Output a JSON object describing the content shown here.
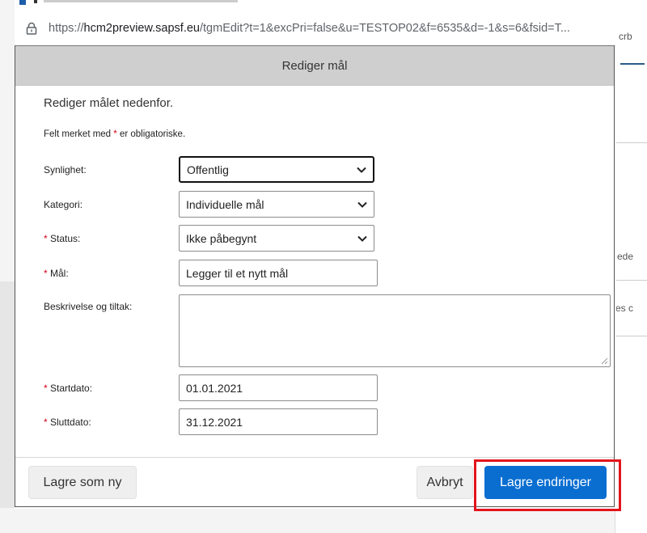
{
  "browser": {
    "url_prefix": "https://",
    "url_host": "hcm2preview.sapsf.eu",
    "url_path": "/tgmEdit?t=1&excPri=false&u=TESTOP02&f=6535&d=-1&s=6&fsid=T..."
  },
  "background": {
    "snippet_1": "crb",
    "snippet_2": "ede",
    "snippet_3": "es c"
  },
  "dialog": {
    "title": "Rediger mål",
    "intro": "Rediger målet nedenfor.",
    "required_note_before": "Felt merket med ",
    "required_star": "*",
    "required_note_after": " er obligatoriske.",
    "fields": {
      "visibility": {
        "label": "Synlighet:",
        "value": "Offentlig"
      },
      "category": {
        "label": "Kategori:",
        "value": "Individuelle mål"
      },
      "status": {
        "label": "Status:",
        "value": "Ikke påbegynt"
      },
      "goal": {
        "label": "Mål:",
        "value": "Legger til et nytt mål"
      },
      "description": {
        "label": "Beskrivelse og tiltak:",
        "value": ""
      },
      "start_date": {
        "label": "Startdato:",
        "value": "01.01.2021"
      },
      "end_date": {
        "label": "Sluttdato:",
        "value": "31.12.2021"
      }
    },
    "required_marker": "*"
  },
  "footer": {
    "save_as_new": "Lagre som ny",
    "cancel": "Avbryt",
    "save_changes": "Lagre endringer"
  },
  "colors": {
    "primary_button": "#0a6ed1",
    "highlight_box": "#e3141b",
    "required_star": "#d0021b",
    "header_bg": "#cfcfcf"
  }
}
